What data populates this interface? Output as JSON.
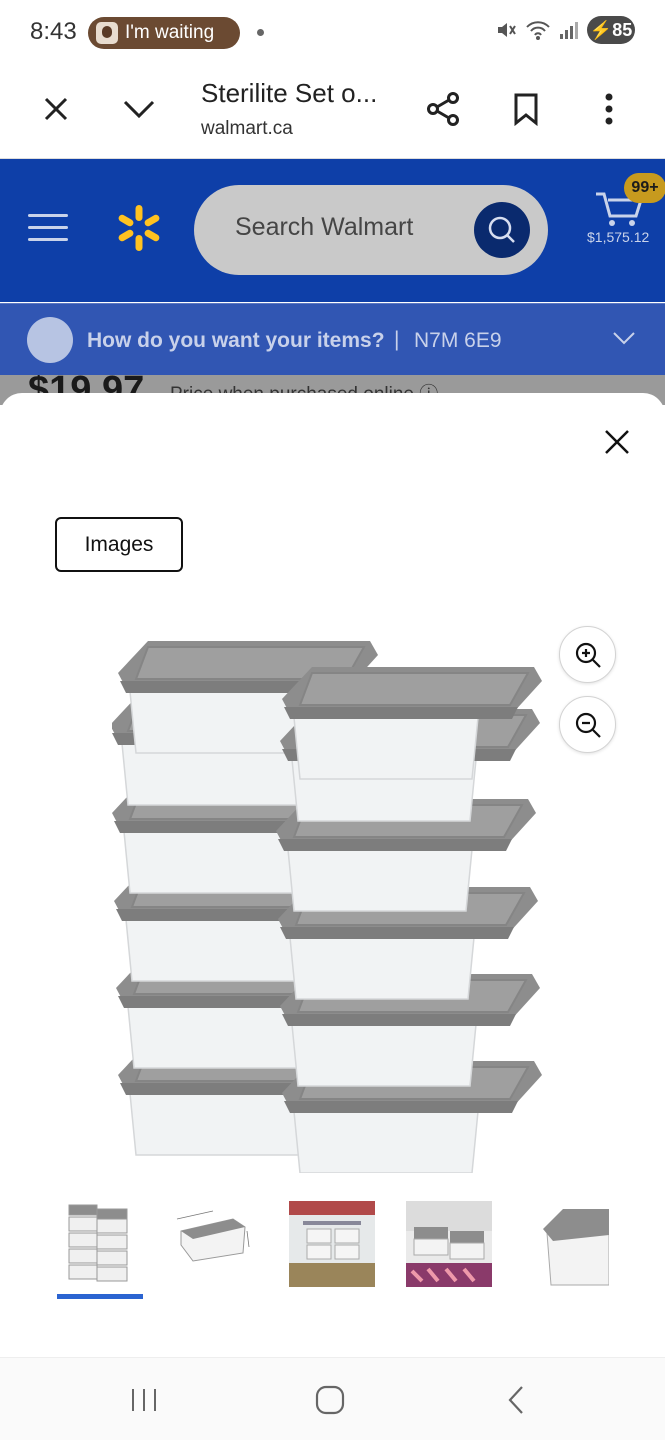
{
  "status": {
    "time": "8:43",
    "notification": "I'm waiting",
    "network": "6E",
    "battery": "85"
  },
  "browser": {
    "title": "Sterilite Set o...",
    "url": "walmart.ca"
  },
  "header": {
    "search_placeholder": "Search Walmart",
    "cart_count": "99+",
    "cart_total": "$1,575.12"
  },
  "delivery": {
    "prompt": "How do you want your items?",
    "separator": "|",
    "postal_code": "N7M 6E9"
  },
  "background": {
    "price": "$19.97",
    "price_note": "Price when purchased online"
  },
  "modal": {
    "tab_label": "Images",
    "thumbnails": [
      "stacked-containers",
      "container-dimensions",
      "closet-shelf",
      "shoe-storage",
      "single-container"
    ],
    "selected_thumbnail": 0
  },
  "colors": {
    "walmart_blue": "#0e3fa8",
    "spark_yellow": "#ffc220",
    "delivery_bar": "#3156b3",
    "selection_blue": "#2b64d1"
  }
}
